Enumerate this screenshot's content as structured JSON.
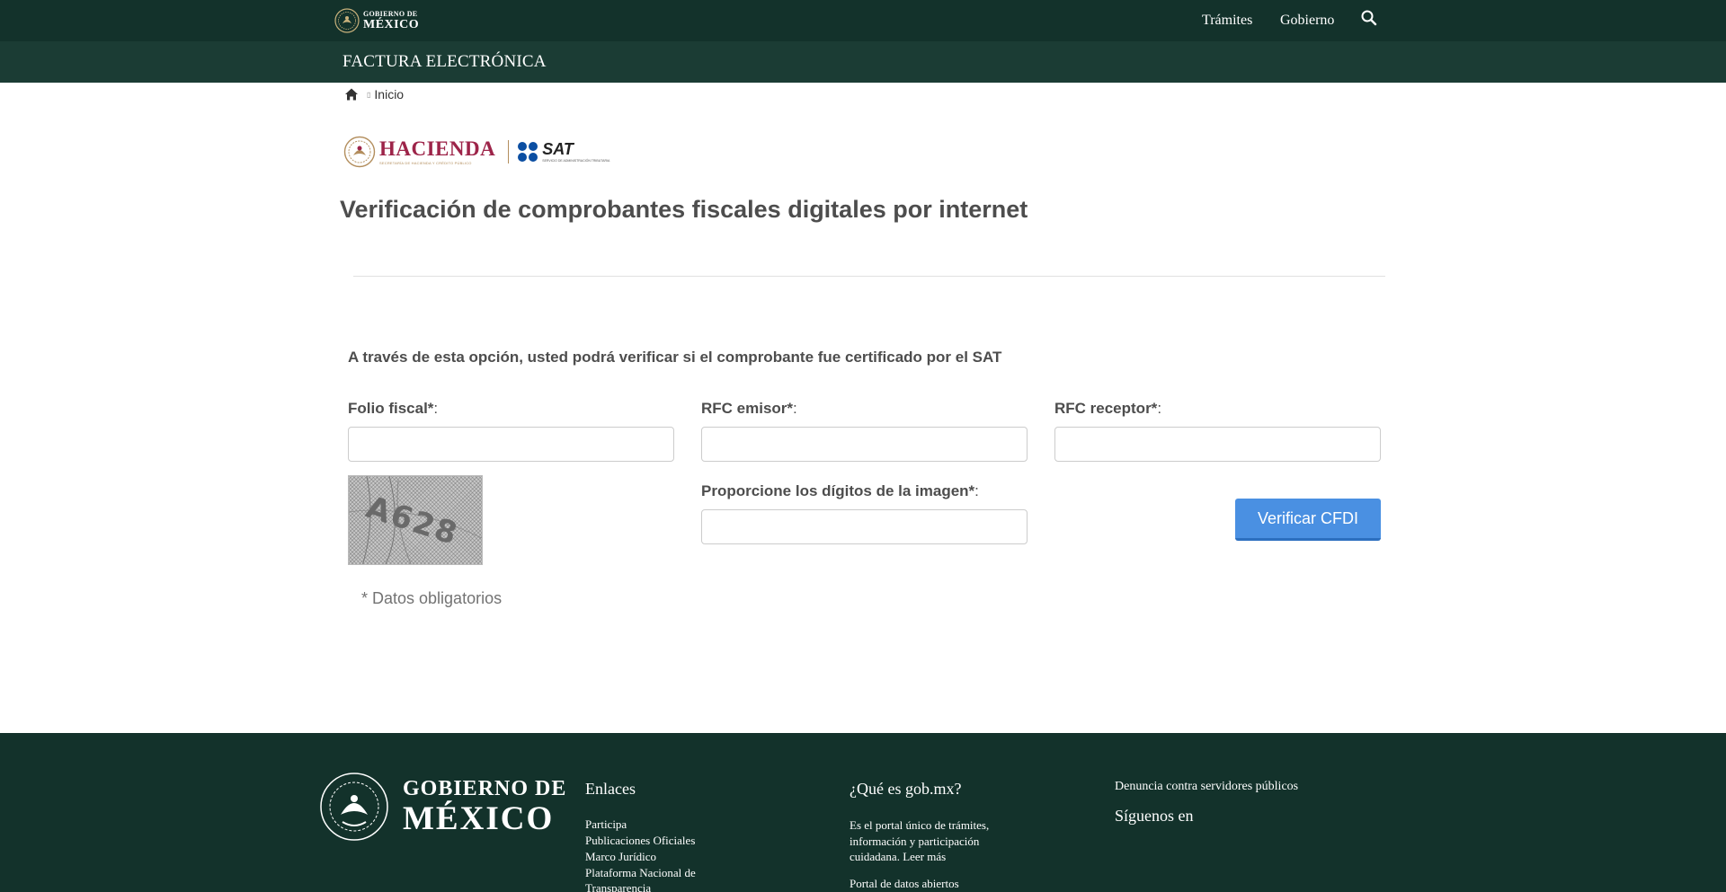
{
  "topbar": {
    "logo_line1": "GOBIERNO DE",
    "logo_line2": "MÉXICO",
    "nav": [
      "Trámites",
      "Gobierno"
    ]
  },
  "subbar": {
    "title": "FACTURA ELECTRÓNICA"
  },
  "breadcrumb": {
    "current": "Inicio"
  },
  "logos": {
    "hacienda": "HACIENDA",
    "hacienda_sub": "SECRETARÍA DE HACIENDA Y CRÉDITO PÚBLICO",
    "sat": "SAT",
    "sat_sub": "SERVICIO DE ADMINISTRACIÓN TRIBUTARIA"
  },
  "page": {
    "title": "Verificación de comprobantes fiscales digitales por internet",
    "intro": "A través de esta opción, usted podrá verificar si el comprobante fue certificado por el SAT"
  },
  "form": {
    "folio_label": "Folio fiscal*",
    "rfc_emisor_label": "RFC emisor*",
    "rfc_receptor_label": "RFC receptor*",
    "captcha_label": "Proporcione los dígitos de la imagen*",
    "colon": ":",
    "captcha_text": "A628",
    "verify_button": "Verificar CFDI",
    "required_note": "* Datos obligatorios"
  },
  "footer": {
    "logo_line1": "GOBIERNO DE",
    "logo_line2": "MÉXICO",
    "enlaces_heading": "Enlaces",
    "enlaces": [
      "Participa",
      "Publicaciones Oficiales",
      "Marco Jurídico",
      "Plataforma Nacional de",
      "Transparencia"
    ],
    "que_es_heading": "¿Qué es gob.mx?",
    "que_es_text": "Es el portal único de trámites, información y participación cuidadana. Leer más",
    "portal_datos": "Portal de datos abiertos",
    "denuncia": "Denuncia contra servidores públicos",
    "siguenos": "Síguenos en"
  },
  "colors": {
    "topbar": "#13322b",
    "subbar": "#1b3c34",
    "button": "#4a90e2",
    "hacienda": "#9d2449",
    "gold": "#b38e5d"
  },
  "icons": [
    "mexico-seal-icon",
    "search-icon",
    "home-icon",
    "hacienda-seal-icon",
    "sat-logo-icon"
  ]
}
